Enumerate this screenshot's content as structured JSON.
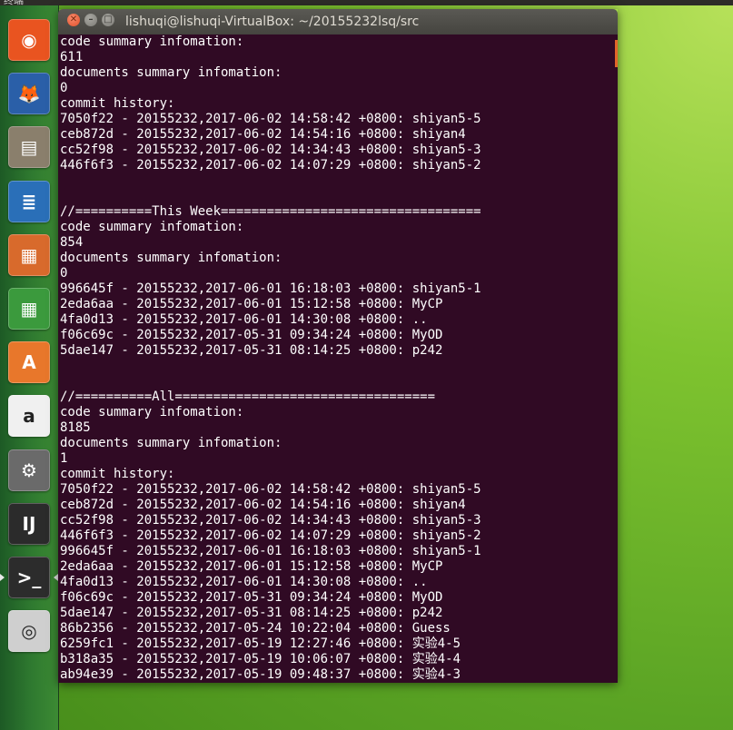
{
  "topbar": {
    "label": "终端"
  },
  "launcher": {
    "items": [
      {
        "name": "ubuntu-dash-icon",
        "glyph": "◉",
        "bg": "#e95420"
      },
      {
        "name": "firefox-icon",
        "glyph": "🦊",
        "bg": "#2a5fa8"
      },
      {
        "name": "files-icon",
        "glyph": "▤",
        "bg": "#8a7f6c"
      },
      {
        "name": "libreoffice-writer-icon",
        "glyph": "≣",
        "bg": "#2a6fb8"
      },
      {
        "name": "libreoffice-impress-icon",
        "glyph": "▦",
        "bg": "#d86a2c"
      },
      {
        "name": "libreoffice-calc-icon",
        "glyph": "▦",
        "bg": "#3b9a3d"
      },
      {
        "name": "software-center-icon",
        "glyph": "A",
        "bg": "#e8772b"
      },
      {
        "name": "amazon-icon",
        "glyph": "a",
        "bg": "#f0f0f0"
      },
      {
        "name": "system-settings-icon",
        "glyph": "⚙",
        "bg": "#6a6a6a"
      },
      {
        "name": "intellij-idea-icon",
        "glyph": "IJ",
        "bg": "#2b2b2b"
      },
      {
        "name": "terminal-icon",
        "glyph": ">_",
        "bg": "#2c2c2c"
      },
      {
        "name": "dvd-icon",
        "glyph": "◎",
        "bg": "#cfcfcf"
      }
    ]
  },
  "window": {
    "title": "lishuqi@lishuqi-VirtualBox: ~/20155232lsq/src",
    "close_glyph": "✕",
    "min_glyph": "–",
    "max_glyph": "□"
  },
  "terminal": {
    "lines": [
      "code summary infomation:",
      "611",
      "documents summary infomation:",
      "0",
      "commit history:",
      "7050f22 - 20155232,2017-06-02 14:58:42 +0800: shiyan5-5",
      "ceb872d - 20155232,2017-06-02 14:54:16 +0800: shiyan4",
      "cc52f98 - 20155232,2017-06-02 14:34:43 +0800: shiyan5-3",
      "446f6f3 - 20155232,2017-06-02 14:07:29 +0800: shiyan5-2",
      "",
      "",
      "//==========This Week==================================",
      "code summary infomation:",
      "854",
      "documents summary infomation:",
      "0",
      "996645f - 20155232,2017-06-01 16:18:03 +0800: shiyan5-1",
      "2eda6aa - 20155232,2017-06-01 15:12:58 +0800: MyCP",
      "4fa0d13 - 20155232,2017-06-01 14:30:08 +0800: ..",
      "f06c69c - 20155232,2017-05-31 09:34:24 +0800: MyOD",
      "5dae147 - 20155232,2017-05-31 08:14:25 +0800: p242",
      "",
      "",
      "//==========All==================================",
      "code summary infomation:",
      "8185",
      "documents summary infomation:",
      "1",
      "commit history:",
      "7050f22 - 20155232,2017-06-02 14:58:42 +0800: shiyan5-5",
      "ceb872d - 20155232,2017-06-02 14:54:16 +0800: shiyan4",
      "cc52f98 - 20155232,2017-06-02 14:34:43 +0800: shiyan5-3",
      "446f6f3 - 20155232,2017-06-02 14:07:29 +0800: shiyan5-2",
      "996645f - 20155232,2017-06-01 16:18:03 +0800: shiyan5-1",
      "2eda6aa - 20155232,2017-06-01 15:12:58 +0800: MyCP",
      "4fa0d13 - 20155232,2017-06-01 14:30:08 +0800: ..",
      "f06c69c - 20155232,2017-05-31 09:34:24 +0800: MyOD",
      "5dae147 - 20155232,2017-05-31 08:14:25 +0800: p242",
      "86b2356 - 20155232,2017-05-24 10:22:04 +0800: Guess",
      "6259fc1 - 20155232,2017-05-19 12:27:46 +0800: 实验4-5",
      "b318a35 - 20155232,2017-05-19 10:06:07 +0800: 实验4-4",
      "ab94e39 - 20155232,2017-05-19 09:48:37 +0800: 实验4-3"
    ]
  },
  "colors": {
    "terminal_bg": "#300a24",
    "terminal_fg": "#ffffff",
    "launcher_bg": "#2f7a30",
    "accent": "#e95420"
  }
}
